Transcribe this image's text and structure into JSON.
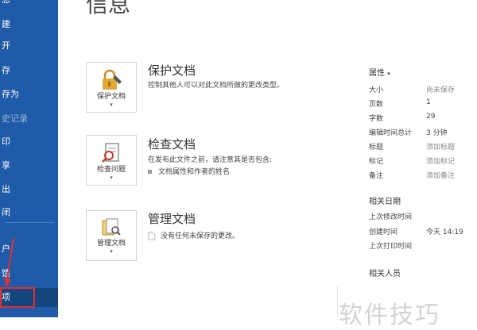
{
  "sidebar": {
    "items": [
      {
        "label": "息"
      },
      {
        "label": "建"
      },
      {
        "label": "开"
      },
      {
        "label": "存"
      },
      {
        "label": "存为"
      },
      {
        "label": "史记录"
      },
      {
        "label": "印"
      },
      {
        "label": "享"
      },
      {
        "label": "出"
      },
      {
        "label": "闭"
      },
      {
        "label": "户"
      },
      {
        "label": "馈"
      },
      {
        "label": "项"
      }
    ]
  },
  "page": {
    "title": "信息"
  },
  "sections": {
    "protect": {
      "icon_label": "保护文档",
      "title": "保护文档",
      "desc": "控制其他人可以对此文档所做的更改类型。"
    },
    "inspect": {
      "icon_label": "检查问题",
      "title": "检查文档",
      "desc": "在发布此文件之前，请注意其是否包含:",
      "bullet": "文档属性和作者的姓名"
    },
    "manage": {
      "icon_label": "管理文档",
      "title": "管理文档",
      "desc": "没有任何未保存的更改。"
    }
  },
  "properties": {
    "header": "属性",
    "rows": [
      {
        "label": "大小",
        "value": "尚未保存"
      },
      {
        "label": "页数",
        "value": "1"
      },
      {
        "label": "字数",
        "value": "29"
      },
      {
        "label": "编辑时间总计",
        "value": "3 分钟"
      },
      {
        "label": "标题",
        "value": "添加标题"
      },
      {
        "label": "标记",
        "value": "添加标记"
      },
      {
        "label": "备注",
        "value": "添加备注"
      }
    ]
  },
  "dates": {
    "header": "相关日期",
    "rows": [
      {
        "label": "上次修改时间",
        "value": ""
      },
      {
        "label": "创建时间",
        "value": "今天 14:19"
      },
      {
        "label": "上次打印时间",
        "value": ""
      }
    ]
  },
  "people": {
    "header": "相关人员"
  },
  "watermark": "软件技巧",
  "colors": {
    "sidebar_bg": "#1f5ba8",
    "highlight_box": "#e03030",
    "lock_icon": "#e0a93a"
  }
}
